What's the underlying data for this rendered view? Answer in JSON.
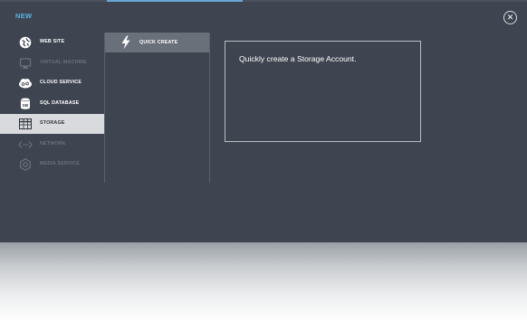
{
  "dialog": {
    "title": "NEW",
    "close_icon": "close-icon",
    "close_glyph": "✕"
  },
  "categories": [
    {
      "label": "WEB SITE",
      "icon": "globe-icon",
      "enabled": true,
      "selected": false
    },
    {
      "label": "VIRTUAL MACHINE",
      "icon": "monitor-icon",
      "enabled": false,
      "selected": false
    },
    {
      "label": "CLOUD SERVICE",
      "icon": "cloud-icon",
      "enabled": true,
      "selected": false
    },
    {
      "label": "SQL DATABASE",
      "icon": "database-icon",
      "enabled": true,
      "selected": false
    },
    {
      "label": "STORAGE",
      "icon": "grid-icon",
      "enabled": true,
      "selected": true
    },
    {
      "label": "NETWORK",
      "icon": "network-icon",
      "enabled": false,
      "selected": false
    },
    {
      "label": "MEDIA SERVICE",
      "icon": "media-icon",
      "enabled": false,
      "selected": false
    }
  ],
  "options": [
    {
      "label": "QUICK CREATE",
      "icon": "lightning-icon",
      "selected": true
    }
  ],
  "description": "Quickly create a Storage Account.",
  "colors": {
    "panel_bg": "#3e4550",
    "title_accent": "#58b4e8",
    "selected_item_bg": "#d8dadd",
    "selected_option_bg": "#6a707a",
    "disabled_text": "#6b727c"
  }
}
